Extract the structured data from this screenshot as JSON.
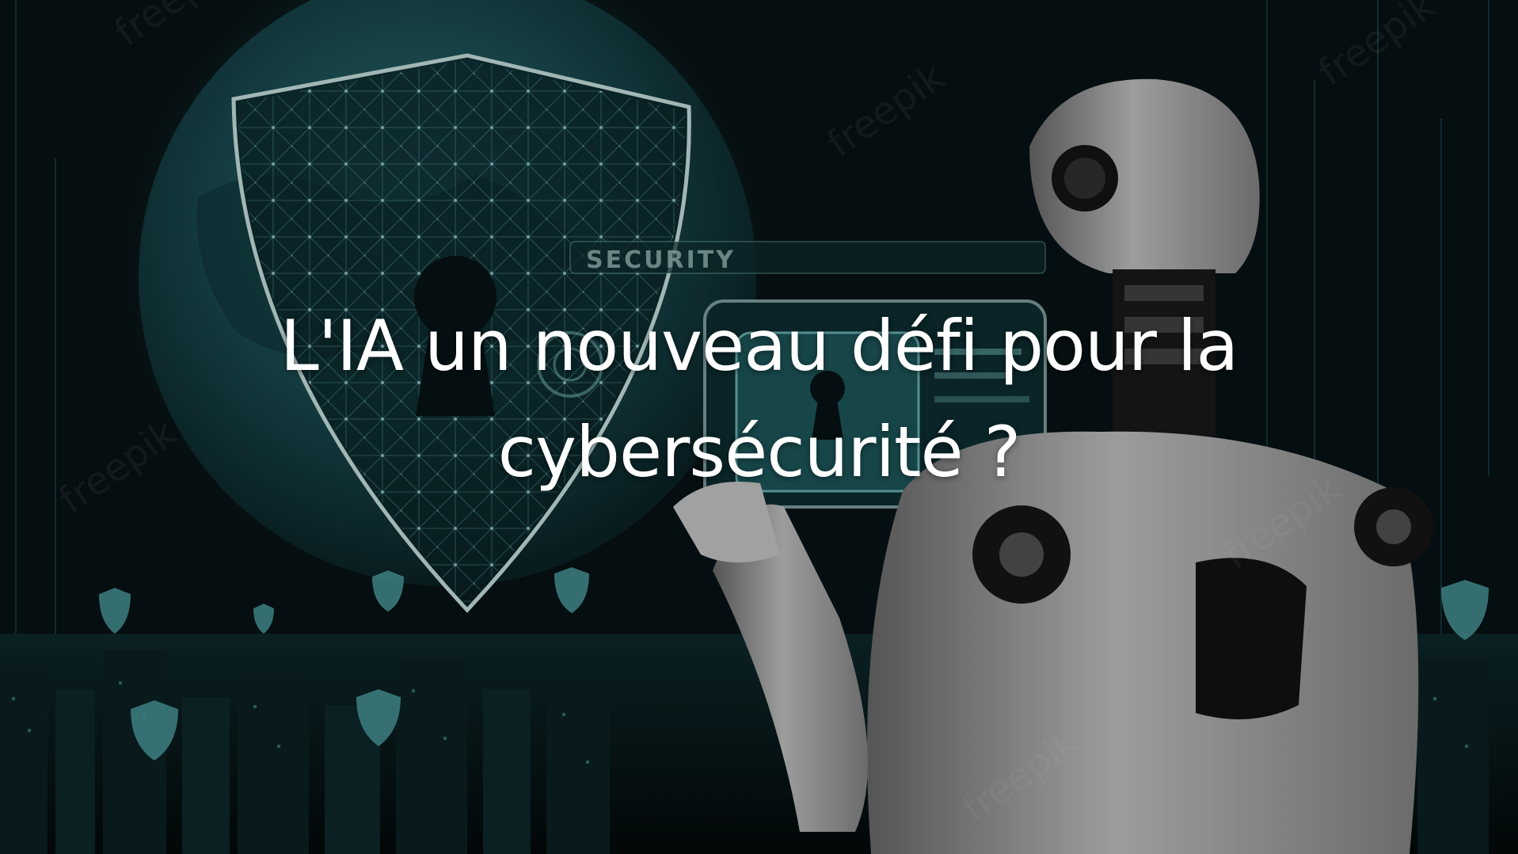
{
  "title": {
    "line1": "L'IA un nouveau défi pour la",
    "line2": "cybersécurité ?"
  },
  "overlay": {
    "security_label": "SECURITY",
    "watermark": "freepik"
  },
  "colors": {
    "background": "#071215",
    "accent_teal": "#3fa7a7",
    "robot_grey": "#b9b9b9",
    "text": "#ffffff"
  }
}
